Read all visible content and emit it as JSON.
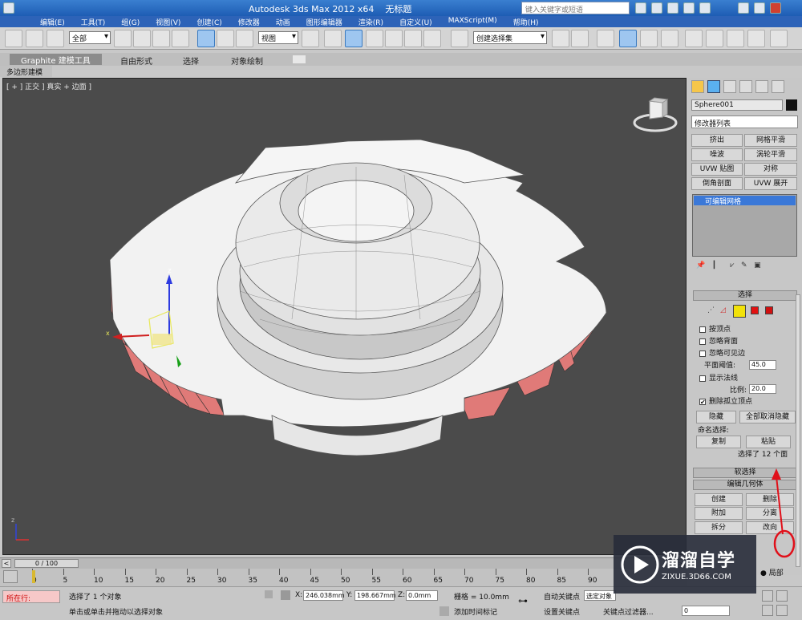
{
  "titlebar": {
    "app_title": "Autodesk 3ds Max  2012 x64",
    "file_title": "无标题",
    "search_placeholder": "键入关键字或短语",
    "menus": [
      "编辑(E)",
      "工具(T)",
      "组(G)",
      "视图(V)",
      "创建(C)",
      "修改器",
      "动画",
      "图形编辑器",
      "渲染(R)",
      "自定义(U)",
      "MAXScript(M)",
      "帮助(H)"
    ]
  },
  "toolbar": {
    "selection_filter": "全部",
    "reference_coord": "视图",
    "named_selection": "创建选择集"
  },
  "ribbon": {
    "tabs": [
      "Graphite 建模工具",
      "自由形式",
      "选择",
      "对象绘制"
    ],
    "sub_label": "多边形建模"
  },
  "viewport": {
    "label": "[ + ] 正交 ] 真实 + 边面 ]"
  },
  "command_panel": {
    "object_name": "Sphere001",
    "modifier_list": "修改器列表",
    "modifier_buttons": [
      "挤出",
      "网格平滑",
      "噪波",
      "涡轮平滑",
      "UVW 贴图",
      "对称",
      "倒角剖面",
      "UVW 展开"
    ],
    "stack_item": "可编辑网格",
    "selection_rollout": {
      "title": "选择",
      "checkboxes": [
        {
          "label": "按顶点",
          "checked": false
        },
        {
          "label": "忽略背面",
          "checked": false
        },
        {
          "label": "忽略可见边",
          "checked": false
        }
      ],
      "plane_threshold_label": "平面阈值:",
      "plane_threshold_value": "45.0",
      "show_normals_label": "显示法线",
      "scale_label": "比例:",
      "scale_value": "20.0",
      "delete_isolated_label": "删除孤立顶点",
      "hide_button": "隐藏",
      "unhide_button": "全部取消隐藏",
      "named_sel_label": "命名选择:",
      "copy_button": "复制",
      "paste_button": "粘贴",
      "selection_status": "选择了 12 个面"
    },
    "soft_selection_title": "软选择",
    "edit_geometry": {
      "title": "编辑几何体",
      "buttons": [
        "创建",
        "删除",
        "附加",
        "分离",
        "拆分",
        "改向"
      ],
      "local_label": "局部"
    }
  },
  "timeslider": {
    "frame": "0 / 100",
    "ticks": [
      "0",
      "5",
      "10",
      "15",
      "20",
      "25",
      "30",
      "35",
      "40",
      "45",
      "50",
      "55",
      "60",
      "65",
      "70",
      "75",
      "80",
      "85",
      "90"
    ]
  },
  "status": {
    "current_label": "所在行:",
    "selected_text": "选择了 1 个对象",
    "prompt_text": "单击或单击并拖动以选择对象",
    "x_label": "X:",
    "x_value": "246.038mm",
    "y_label": "Y:",
    "y_value": "198.667mm",
    "z_label": "Z:",
    "z_value": "0.0mm",
    "grid_text": "栅格 = 10.0mm",
    "add_time_tag": "添加时间标记",
    "auto_key": "自动关键点",
    "selected_obj": "选定对象",
    "set_key": "设置关键点",
    "key_filter": "关键点过滤器...",
    "frame_field": "0"
  },
  "watermark": {
    "name": "溜溜自学",
    "url": "ZIXUE.3D66.COM"
  },
  "colors": {
    "viewport_bg": "#4b4b4b",
    "selected_face": "#e07a78",
    "annotation": "#e0101a"
  }
}
